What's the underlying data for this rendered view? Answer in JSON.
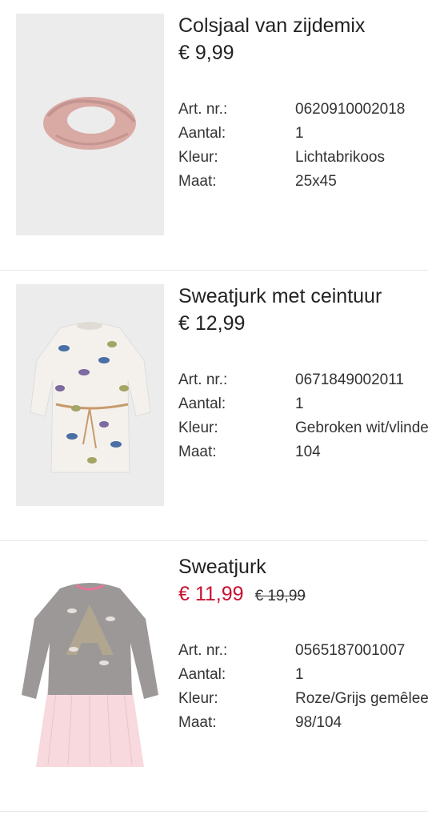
{
  "items": [
    {
      "name": "Colsjaal van zijdemix",
      "price": "€ 9,99",
      "old_price": "",
      "image": "pink-scarf",
      "details": [
        {
          "label": "Art. nr.:",
          "value": "0620910002018"
        },
        {
          "label": "Aantal:",
          "value": "1"
        },
        {
          "label": "Kleur:",
          "value": "Lichtabrikoos"
        },
        {
          "label": "Maat:",
          "value": "25x45"
        }
      ]
    },
    {
      "name": "Sweatjurk met ceintuur",
      "price": "€ 12,99",
      "old_price": "",
      "image": "butterfly-sweat-dress",
      "details": [
        {
          "label": "Art. nr.:",
          "value": "0671849002011"
        },
        {
          "label": "Aantal:",
          "value": "1"
        },
        {
          "label": "Kleur:",
          "value": "Gebroken wit/vlinders"
        },
        {
          "label": "Maat:",
          "value": "104"
        }
      ]
    },
    {
      "name": "Sweatjurk",
      "price": "€ 11,99",
      "old_price": "€ 19,99",
      "image": "grey-pink-sweat-dress",
      "details": [
        {
          "label": "Art. nr.:",
          "value": "0565187001007"
        },
        {
          "label": "Aantal:",
          "value": "1"
        },
        {
          "label": "Kleur:",
          "value": "Roze/Grijs gemêleerd"
        },
        {
          "label": "Maat:",
          "value": "98/104"
        }
      ]
    }
  ],
  "colors": {
    "sale_price": "#c8102e",
    "divider": "#e6e6e6",
    "image_bg": "#ececec"
  }
}
